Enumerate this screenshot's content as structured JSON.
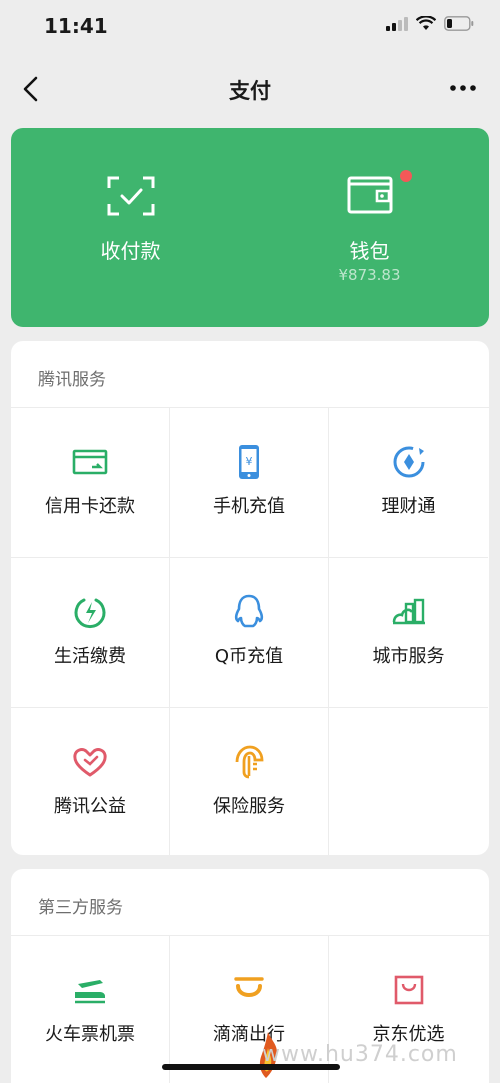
{
  "status": {
    "time": "11:41"
  },
  "nav": {
    "title": "支付"
  },
  "wallet_card": {
    "receive": {
      "label": "收付款",
      "icon": "scan-check-icon"
    },
    "wallet": {
      "label": "钱包",
      "balance": "¥873.83",
      "icon": "wallet-icon",
      "has_badge": true
    }
  },
  "tencent_services": {
    "title": "腾讯服务",
    "items": [
      {
        "label": "信用卡还款",
        "icon": "credit-card-icon",
        "color": "#2aae67"
      },
      {
        "label": "手机充值",
        "icon": "phone-topup-icon",
        "color": "#3b8fde"
      },
      {
        "label": "理财通",
        "icon": "wealth-icon",
        "color": "#3b8fde"
      },
      {
        "label": "生活缴费",
        "icon": "utility-bolt-icon",
        "color": "#2aae67"
      },
      {
        "label": "Q币充值",
        "icon": "qq-penguin-icon",
        "color": "#3b8fde"
      },
      {
        "label": "城市服务",
        "icon": "city-icon",
        "color": "#2aae67"
      },
      {
        "label": "腾讯公益",
        "icon": "charity-heart-icon",
        "color": "#e05a6a"
      },
      {
        "label": "保险服务",
        "icon": "insurance-umbrella-icon",
        "color": "#f0a020"
      }
    ]
  },
  "third_party_services": {
    "title": "第三方服务",
    "items": [
      {
        "label": "火车票机票",
        "icon": "train-plane-icon",
        "color": "#2aae67"
      },
      {
        "label": "滴滴出行",
        "icon": "didi-icon",
        "color": "#f0a020"
      },
      {
        "label": "京东优选",
        "icon": "shopping-bag-icon",
        "color": "#e05a6a"
      }
    ]
  },
  "watermark": "www.hu374.com"
}
